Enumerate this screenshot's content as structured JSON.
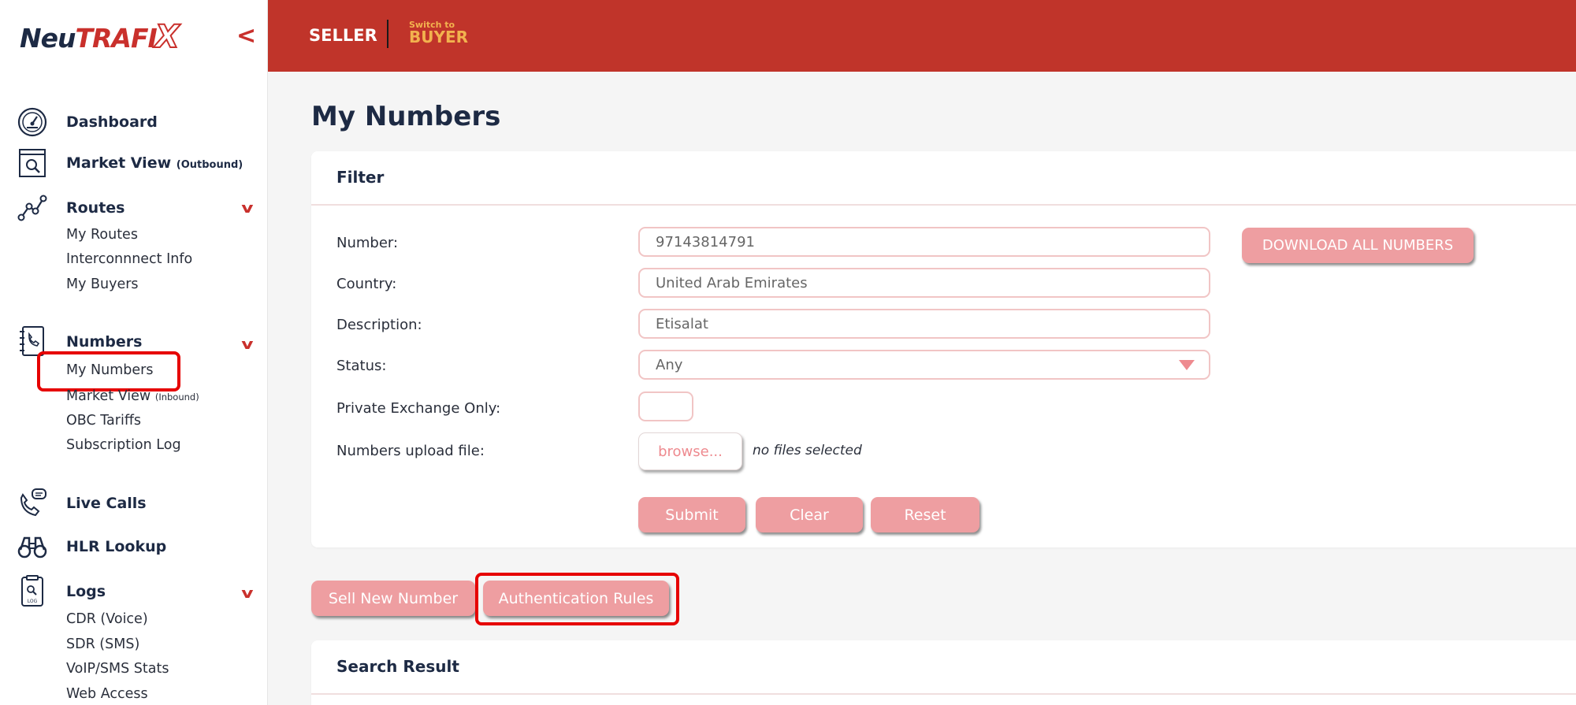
{
  "brand": {
    "logo_part1": "Neu",
    "logo_part2": "TRAFI",
    "logo_part3": "X"
  },
  "sidebar": {
    "collapse_glyph": "<",
    "expand_glyph": "v",
    "dashboard": "Dashboard",
    "market_view_out": "Market View",
    "market_view_out_suffix": "(Outbound)",
    "routes": "Routes",
    "routes_items": [
      "My Routes",
      "Interconnnect Info",
      "My Buyers"
    ],
    "numbers": "Numbers",
    "numbers_items": {
      "my_numbers": "My Numbers",
      "market_view_in": "Market View",
      "market_view_in_suffix": "(Inbound)",
      "obc_tariffs": "OBC Tariffs",
      "subscription_log": "Subscription Log"
    },
    "live_calls": "Live Calls",
    "hlr_lookup": "HLR Lookup",
    "logs": "Logs",
    "logs_items": [
      "CDR (Voice)",
      "SDR (SMS)",
      "VoIP/SMS Stats",
      "Web Access"
    ]
  },
  "topbar": {
    "seller": "SELLER",
    "switch_to": "Switch to",
    "buyer": "BUYER"
  },
  "main": {
    "title": "My Numbers",
    "filter": {
      "title": "Filter",
      "number_label": "Number:",
      "number_value": "97143814791",
      "country_label": "Country:",
      "country_value": "United Arab Emirates",
      "description_label": "Description:",
      "description_value": "Etisalat",
      "status_label": "Status:",
      "status_value": "Any",
      "private_label": "Private Exchange Only:",
      "upload_label": "Numbers upload file:",
      "browse": "browse...",
      "no_files": "no files selected",
      "download_all": "DOWNLOAD ALL NUMBERS",
      "submit": "Submit",
      "clear": "Clear",
      "reset": "Reset"
    },
    "sell_new_number": "Sell New Number",
    "authentication_rules": "Authentication Rules",
    "search_result": "Search Result"
  },
  "colors": {
    "brand_red": "#c0342a",
    "accent_gold": "#f2b24e",
    "button_pink": "#ee9ea1",
    "highlight": "#e60000"
  }
}
